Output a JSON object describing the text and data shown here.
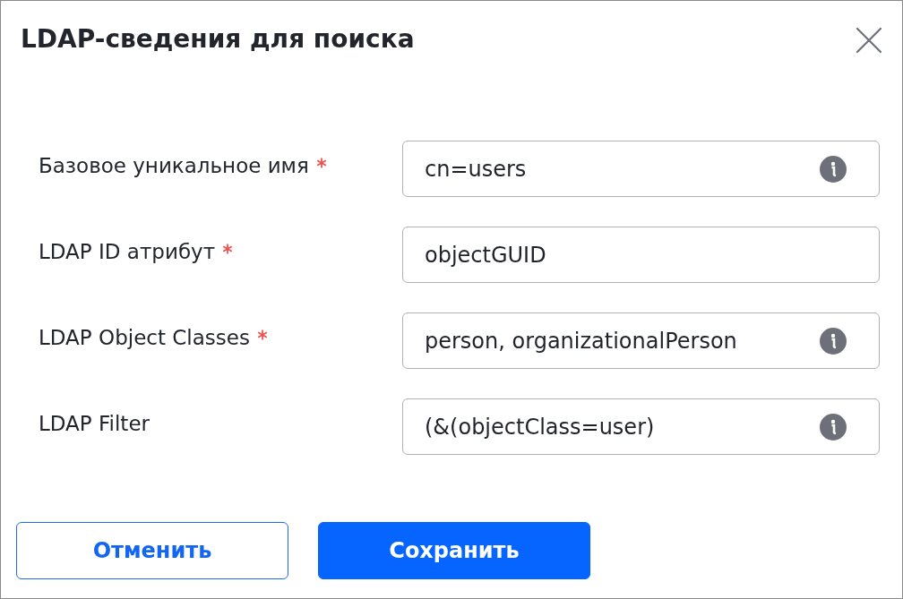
{
  "dialog": {
    "title": "LDAP-сведения для поиска"
  },
  "fields": [
    {
      "label": "Базовое уникальное имя",
      "required": true,
      "value": "cn=users",
      "info": true
    },
    {
      "label": "LDAP ID атрибут",
      "required": true,
      "value": "objectGUID",
      "info": false
    },
    {
      "label": "LDAP Object Classes",
      "required": true,
      "value": "person, organizationalPerson",
      "info": true
    },
    {
      "label": "LDAP Filter",
      "required": false,
      "value": "(&(objectClass=user)",
      "info": true
    }
  ],
  "buttons": [
    {
      "label": "Отменить",
      "kind": "secondary"
    },
    {
      "label": "Сохранить",
      "kind": "primary"
    }
  ]
}
